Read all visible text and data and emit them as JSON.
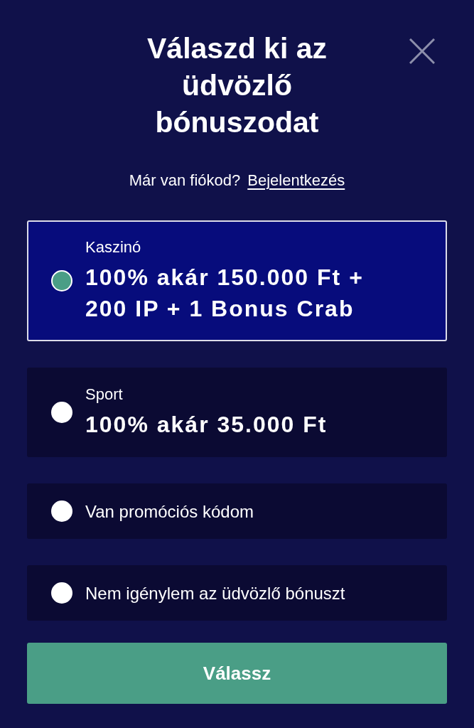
{
  "title": "Válaszd ki az üdvözlő bónuszodat",
  "login_prompt": {
    "text": "Már van fiókod?",
    "link": "Bejelentkezés"
  },
  "options": [
    {
      "kind": "offer",
      "category": "Kaszinó",
      "title": "100% akár 150.000 Ft + 200 IP + 1 Bonus Crab",
      "selected": true
    },
    {
      "kind": "offer",
      "category": "Sport",
      "title": "100% akár 35.000 Ft",
      "selected": false
    },
    {
      "kind": "simple",
      "title": "Van promóciós kódom",
      "selected": false
    },
    {
      "kind": "simple",
      "title": "Nem igénylem az üdvözlő bónuszt",
      "selected": false
    }
  ],
  "submit_button": "Válassz"
}
